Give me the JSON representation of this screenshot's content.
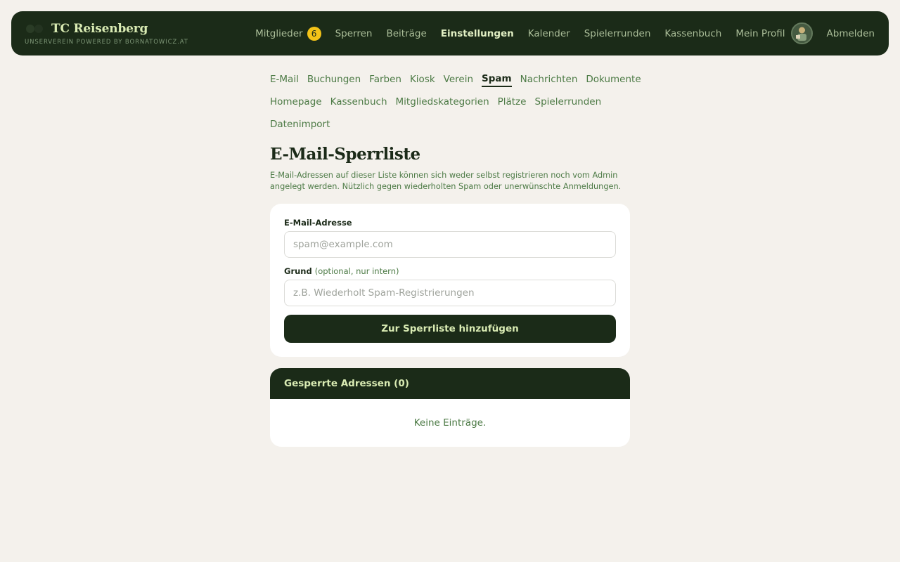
{
  "header": {
    "title": "TC Reisenberg",
    "subtitle": "UNSERVEREIN POWERED BY BORNATOWICZ.AT",
    "nav": {
      "members": "Mitglieder",
      "members_badge": "6",
      "bans": "Sperren",
      "fees": "Beiträge",
      "settings": "Einstellungen",
      "calendar": "Kalender",
      "rounds": "Spielerrunden",
      "cashbook": "Kassenbuch",
      "profile": "Mein Profil",
      "logout": "Abmelden"
    }
  },
  "subnav": {
    "email": "E-Mail",
    "bookings": "Buchungen",
    "colors": "Farben",
    "kiosk": "Kiosk",
    "club": "Verein",
    "spam": "Spam",
    "messages": "Nachrichten",
    "documents": "Dokumente",
    "homepage": "Homepage",
    "cashbook": "Kassenbuch",
    "member_categories": "Mitgliedskategorien",
    "courts": "Plätze",
    "rounds": "Spielerrunden",
    "data_import": "Datenimport"
  },
  "page": {
    "title": "E-Mail-Sperrliste",
    "description": "E-Mail-Adressen auf dieser Liste können sich weder selbst registrieren noch vom Admin angelegt werden. Nützlich gegen wiederholten Spam oder unerwünschte Anmeldungen."
  },
  "form": {
    "email_label": "E-Mail-Adresse",
    "email_placeholder": "spam@example.com",
    "email_value": "",
    "reason_label": "Grund",
    "reason_optional": "(optional, nur intern)",
    "reason_placeholder": "z.B. Wiederholt Spam-Registrierungen",
    "reason_value": "",
    "submit_label": "Zur Sperrliste hinzufügen"
  },
  "blocked": {
    "title": "Gesperrte Adressen (0)",
    "empty_text": "Keine Einträge."
  },
  "colors": {
    "primary": "#1b2b18",
    "accent": "#d9ebb3",
    "badge": "#f3c318",
    "link": "#4c7a45",
    "background": "#f4f1ec"
  }
}
